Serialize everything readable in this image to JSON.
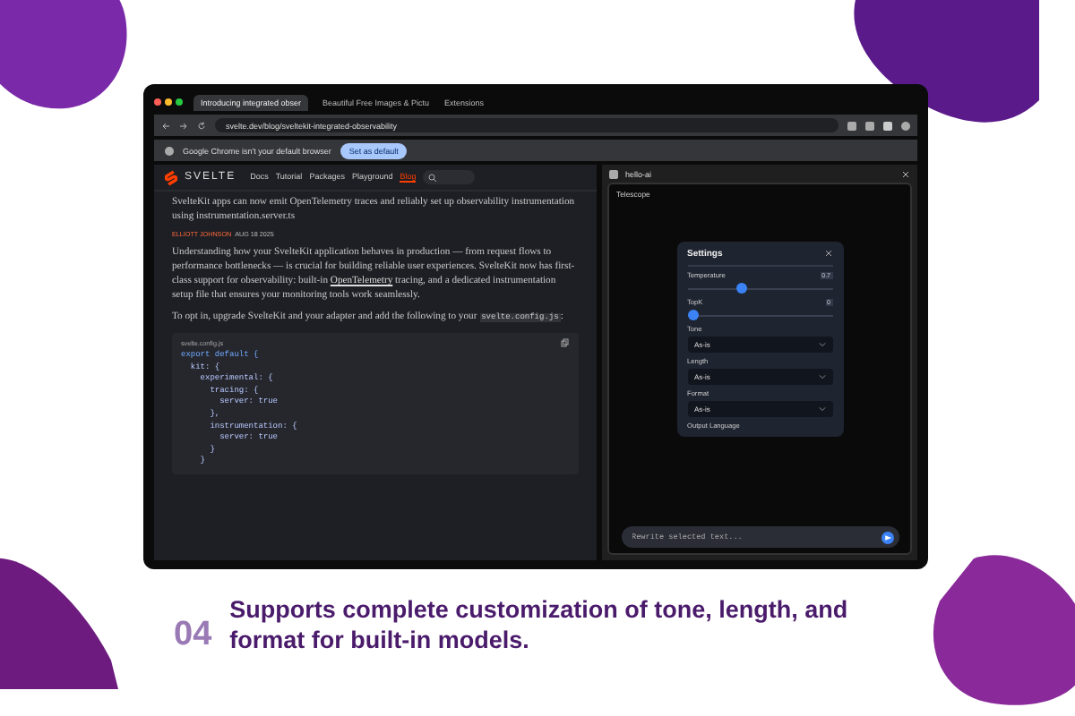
{
  "browser": {
    "tabs": [
      {
        "label": "Introducing integrated obser",
        "selected": true
      },
      {
        "label": "Beautiful Free Images & Pictu",
        "selected": false
      },
      {
        "label": "Extensions",
        "selected": false
      }
    ],
    "url": "svelte.dev/blog/sveltekit-integrated-observability",
    "infobar": {
      "message": "Google Chrome isn't your default browser",
      "button": "Set as default"
    }
  },
  "page": {
    "logo": "SVELTE",
    "nav": [
      {
        "label": "Docs",
        "selected": false
      },
      {
        "label": "Tutorial",
        "selected": false
      },
      {
        "label": "Packages",
        "selected": false
      },
      {
        "label": "Playground",
        "selected": false
      },
      {
        "label": "Blog",
        "selected": true
      }
    ],
    "intro": "SvelteKit apps can now emit OpenTelemetry traces and reliably set up observability instrumentation using instrumentation.server.ts",
    "author": "ELLIOTT JOHNSON",
    "date": "AUG 18 2025",
    "paragraph_1": {
      "before": "Understanding how your SvelteKit application behaves in production — from request flows to performance bottlenecks — is crucial for building reliable user experiences. SvelteKit now has first-class support for observability: built-in",
      "link": "OpenTelemetry",
      "after": "tracing, and a dedicated instrumentation setup file that ensures your monitoring tools work seamlessly."
    },
    "paragraph_2": "To opt in, upgrade SvelteKit and your adapter and add the following to your",
    "inline_code": "svelte.config.js",
    "paragraph_2_end": ":",
    "code": {
      "filename": "svelte.config.js",
      "lines": [
        {
          "text": "export default {",
          "kind": "keyword"
        },
        {
          "text": "  kit: {",
          "kind": "plain"
        },
        {
          "text": "    experimental: {",
          "kind": "plain"
        },
        {
          "text": "      tracing: {",
          "kind": "plain"
        },
        {
          "text": "        server: true",
          "kind": "plain"
        },
        {
          "text": "      },",
          "kind": "plain"
        },
        {
          "text": "      instrumentation: {",
          "kind": "plain"
        },
        {
          "text": "        server: true",
          "kind": "plain"
        },
        {
          "text": "      }",
          "kind": "plain"
        },
        {
          "text": "    }",
          "kind": "plain"
        }
      ]
    }
  },
  "side_panel": {
    "title": "hello-ai",
    "section": "Telescope",
    "settings": {
      "title": "Settings",
      "controls": [
        {
          "kind": "slider",
          "label": "Temperature",
          "value": "0.7",
          "level": 0.36
        },
        {
          "kind": "slider",
          "label": "TopK",
          "value": "0",
          "level": 0
        },
        {
          "kind": "select",
          "label": "Tone",
          "value": "As-is"
        },
        {
          "kind": "select",
          "label": "Length",
          "value": "As-is"
        },
        {
          "kind": "select",
          "label": "Format",
          "value": "As-is"
        },
        {
          "kind": "label",
          "label": "Output Language"
        }
      ]
    },
    "input": {
      "placeholder": "Rewrite selected text..."
    }
  },
  "caption": {
    "number": "04",
    "text": "Supports complete customization of tone, length, and format for built-in models."
  }
}
